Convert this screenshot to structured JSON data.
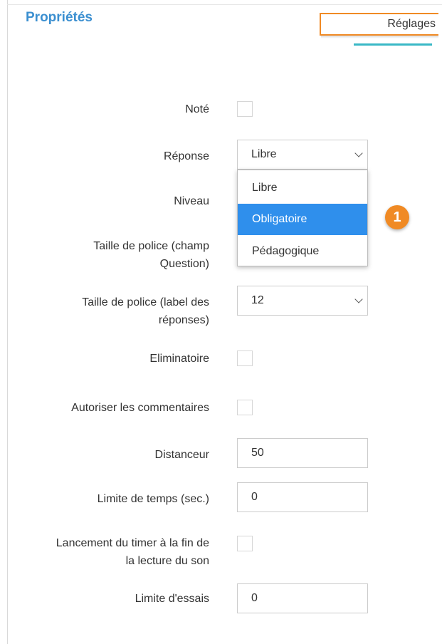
{
  "header": {
    "title": "Propriétés",
    "tab_settings": "Réglages"
  },
  "fields": {
    "note": {
      "label": "Noté"
    },
    "reponse": {
      "label": "Réponse",
      "value": "Libre"
    },
    "niveau": {
      "label": "Niveau"
    },
    "taille_question": {
      "label_line1": "Taille de police (champ",
      "label_line2": "Question)"
    },
    "taille_reponses": {
      "label_line1": "Taille de police (label des",
      "label_line2": "réponses)",
      "value": "12"
    },
    "eliminatoire": {
      "label": "Eliminatoire"
    },
    "commentaires": {
      "label": "Autoriser les commentaires"
    },
    "distanceur": {
      "label": "Distanceur",
      "value": "50"
    },
    "limite_temps": {
      "label": "Limite de temps (sec.)",
      "value": "0"
    },
    "timer": {
      "label_line1": "Lancement du timer à la fin de",
      "label_line2": "la lecture du son"
    },
    "limite_essais": {
      "label": "Limite d'essais",
      "value": "0"
    }
  },
  "dropdown": {
    "options": [
      "Libre",
      "Obligatoire",
      "Pédagogique"
    ],
    "selected": "Obligatoire"
  },
  "annotation": {
    "number": "1"
  },
  "colors": {
    "title": "#3b8fd0",
    "highlight": "#f08a24",
    "tab_underline": "#39b8c6",
    "option_selected": "#2f8fec"
  }
}
